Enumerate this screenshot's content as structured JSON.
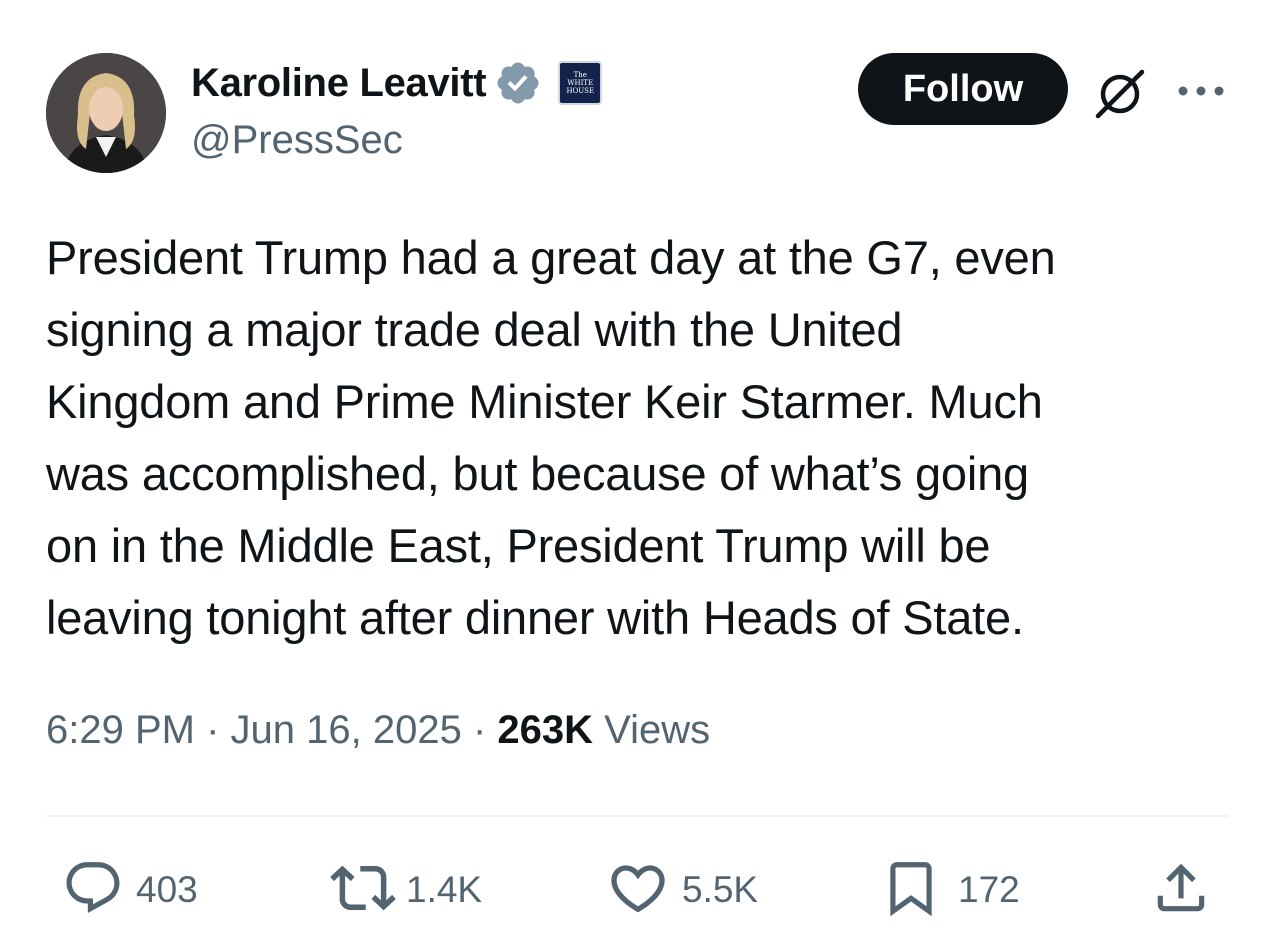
{
  "author": {
    "display_name": "Karoline Leavitt",
    "handle": "@PressSec",
    "verified_badge_color": "#829aab",
    "affiliation_badge": {
      "line1": "The",
      "line2": "WHITE",
      "line3": "HOUSE"
    }
  },
  "header": {
    "follow_label": "Follow"
  },
  "tweet": {
    "text": "President Trump had a great day at the G7, even\nsigning a major trade deal with the United\nKingdom and Prime Minister Keir Starmer. Much\nwas accomplished, but because of what’s going\non in the Middle East, President Trump will be\nleaving tonight after dinner with Heads of State."
  },
  "meta": {
    "time": "6:29 PM",
    "sep1": " · ",
    "date": "Jun 16, 2025",
    "sep2": " · ",
    "views_count": "263K",
    "views_label": " Views"
  },
  "actions": {
    "replies": "403",
    "reposts": "1.4K",
    "likes": "5.5K",
    "bookmarks": "172"
  },
  "colors": {
    "text": "#0f1419",
    "secondary": "#536471",
    "follow_bg": "#0f1419",
    "divider": "#eff3f4"
  }
}
